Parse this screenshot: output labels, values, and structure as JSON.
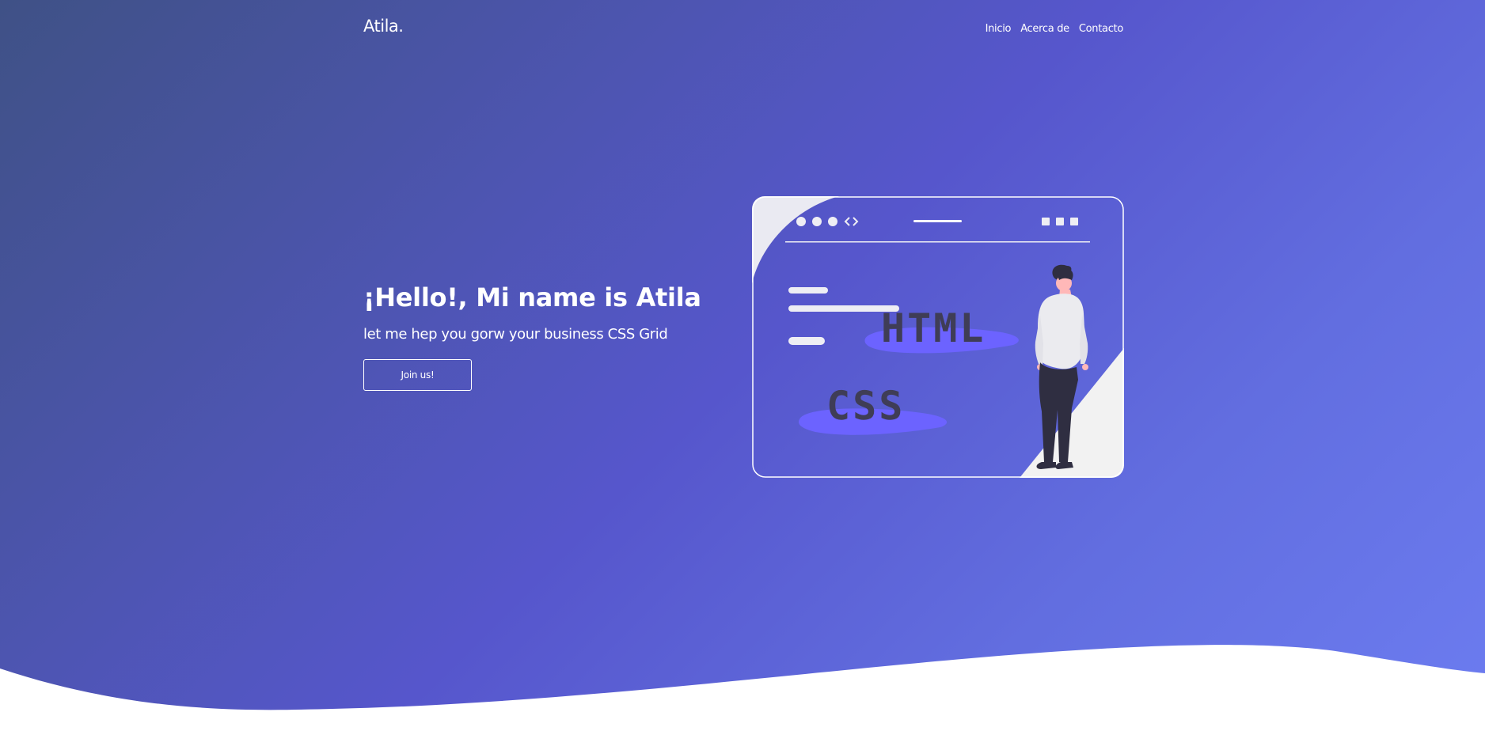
{
  "header": {
    "logo": "Atila.",
    "nav": [
      "Inicio",
      "Acerca de",
      "Contacto"
    ]
  },
  "hero": {
    "title": "¡Hello!, Mi name is Atila",
    "subtitle": "let me hep you gorw your business CSS Grid",
    "cta_label": "Join us!"
  },
  "illustration": {
    "html_label": "HTML",
    "css_label": "CSS"
  },
  "colors": {
    "gradient_start": "#3f5186",
    "gradient_mid": "#5656cc",
    "gradient_end": "#6c7cf0",
    "accent_purple": "#6c63ff",
    "code_text": "#3f3d56",
    "panel_light": "#f2f2f2"
  }
}
